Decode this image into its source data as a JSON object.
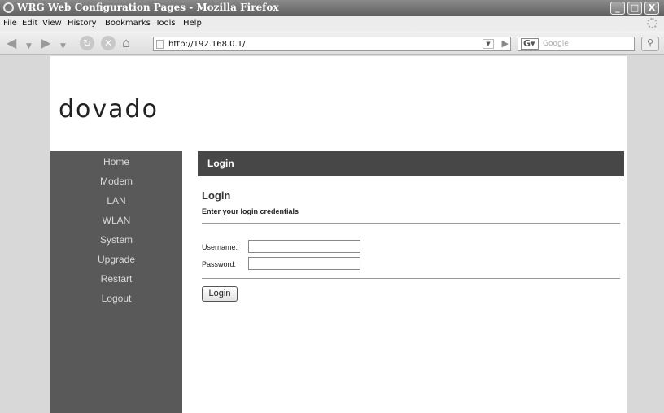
{
  "window": {
    "title": "WRG Web Configuration Pages - Mozilla Firefox",
    "minimize": "_",
    "maximize": "□",
    "close": "X"
  },
  "menu": [
    "File",
    "Edit",
    "View",
    "History",
    "Bookmarks",
    "Tools",
    "Help"
  ],
  "toolbar": {
    "back_icon": "back-arrow-icon",
    "forward_icon": "forward-arrow-icon",
    "url": "http://192.168.0.1/",
    "search_engine": "G",
    "search_placeholder": "Google"
  },
  "site": {
    "logo": "dovado"
  },
  "sidebar": {
    "items": [
      "Home",
      "Modem",
      "LAN",
      "WLAN",
      "System",
      "Upgrade",
      "Restart",
      "Logout"
    ]
  },
  "main": {
    "header": "Login",
    "heading": "Login",
    "subheading": "Enter your login credentials",
    "username_label": "Username:",
    "username_value": "",
    "password_label": "Password:",
    "password_value": "",
    "login_button": "Login"
  },
  "colors": {
    "sidebar_bg": "#595959",
    "header_bg": "#474747"
  }
}
